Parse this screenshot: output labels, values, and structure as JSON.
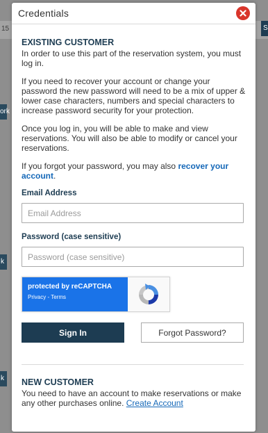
{
  "background": {
    "fragments": [
      "15",
      "ork",
      "k",
      "k",
      "S"
    ]
  },
  "modal": {
    "title": "Credentials",
    "close_icon": "close-icon",
    "existing": {
      "heading": "EXISTING CUSTOMER",
      "intro": "In order to use this part of the reservation system, you must log in.",
      "password_rules": "If you need to recover your account or change your password the new password will need to be a mix of upper & lower case characters, numbers and special characters to increase password security for your protection.",
      "after_login": "Once you log in, you will be able to make and view reservations. You will also be able to modify or cancel your reservations.",
      "forgot_prefix": "If you forgot your password, you may also ",
      "forgot_link": "recover your account",
      "forgot_suffix": "."
    },
    "email": {
      "label": "Email Address",
      "placeholder": "Email Address",
      "value": ""
    },
    "password": {
      "label": "Password (case sensitive)",
      "placeholder": "Password (case sensitive)",
      "value": ""
    },
    "recaptcha": {
      "title": "protected by reCAPTCHA",
      "privacy": "Privacy",
      "separator": " - ",
      "terms": "Terms",
      "icon": "recaptcha-logo-icon"
    },
    "buttons": {
      "sign_in": "Sign In",
      "forgot_password": "Forgot Password?"
    },
    "new_customer": {
      "heading": "NEW CUSTOMER",
      "text": "You need to have an account to make reservations or make any other purchases online. ",
      "link": "Create Account"
    }
  },
  "colors": {
    "accent": "#1d3c52",
    "link": "#1568b8",
    "close": "#d9352b",
    "recaptcha": "#1a73e8"
  }
}
